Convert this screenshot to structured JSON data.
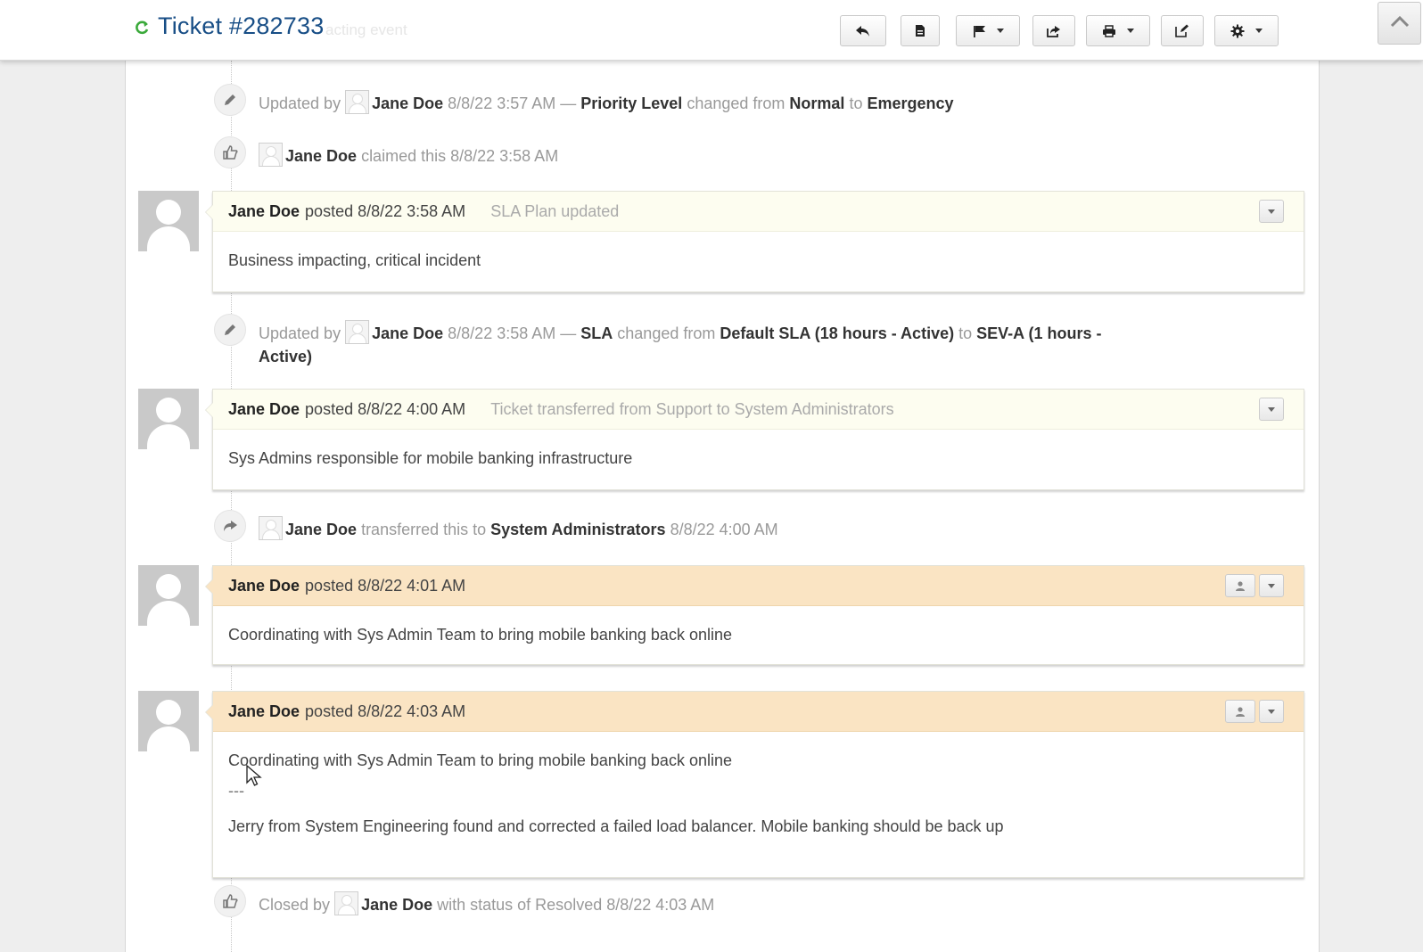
{
  "header": {
    "ticket_title": "Ticket #282733",
    "ghost_subject": "acting event",
    "toolbar": {
      "reply_icon": "reply-icon",
      "save_icon": "file-icon",
      "flag_icon": "flag-icon",
      "transfer_icon": "share-icon",
      "print_icon": "print-icon",
      "edit_icon": "edit-icon",
      "settings_icon": "gear-icon"
    }
  },
  "thread": {
    "event1": {
      "prefix": "Updated by",
      "user": "Jane Doe",
      "time": "8/8/22 3:57 AM —",
      "field": "Priority Level",
      "changed": "changed from",
      "from": "Normal",
      "to_word": "to",
      "to": "Emergency"
    },
    "event2": {
      "user": "Jane Doe",
      "action": "claimed this 8/8/22 3:58 AM"
    },
    "post1": {
      "author": "Jane Doe",
      "posted": "posted 8/8/22 3:58 AM",
      "title": "SLA Plan updated",
      "body": "Business impacting, critical incident"
    },
    "event3": {
      "prefix": "Updated by",
      "user": "Jane Doe",
      "time": "8/8/22 3:58 AM —",
      "field": "SLA",
      "changed": "changed from",
      "from": "Default SLA (18 hours - Active)",
      "to_word": "to",
      "to_line1": "SEV-A (1 hours -",
      "to_line2": "Active)"
    },
    "post2": {
      "author": "Jane Doe",
      "posted": "posted 8/8/22 4:00 AM",
      "title": "Ticket transferred from Support to System Administrators",
      "body": "Sys Admins responsible for mobile banking infrastructure"
    },
    "event4": {
      "user": "Jane Doe",
      "action": "transferred this to",
      "target": "System Administrators",
      "time": "8/8/22 4:00 AM"
    },
    "post3": {
      "author": "Jane Doe",
      "posted": "posted 8/8/22 4:01 AM",
      "body": "Coordinating with Sys Admin Team to bring mobile banking back online"
    },
    "post4": {
      "author": "Jane Doe",
      "posted": "posted 8/8/22 4:03 AM",
      "body_line1": "Coordinating with Sys Admin Team to bring mobile banking back online",
      "separator": "---",
      "body_line2": "Jerry from System Engineering found and corrected a failed load balancer. Mobile banking should be back up"
    },
    "event5": {
      "prefix": "Closed by",
      "user": "Jane Doe",
      "action": "with status of Resolved 8/8/22 4:03 AM"
    }
  },
  "colors": {
    "title": "#184e86",
    "refresh": "#3aa93a",
    "note_header": "#fdfdf0",
    "response_header": "#fae4c3"
  }
}
